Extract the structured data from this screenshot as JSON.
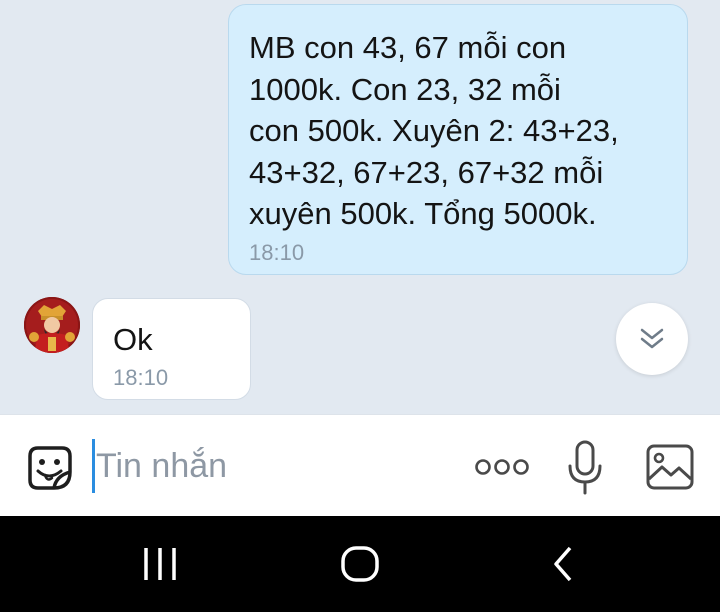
{
  "messages": {
    "outgoing": {
      "text": "MB con 43, 67 mỗi con\n1000k. Con 23, 32 mỗi\ncon 500k. Xuyên 2: 43+23,\n43+32, 67+23, 67+32 mỗi\nxuyên 500k. Tổng 5000k.",
      "time": "18:10"
    },
    "incoming": {
      "text": "Ok",
      "time": "18:10"
    }
  },
  "composer": {
    "placeholder": "Tin nhắn",
    "value": ""
  },
  "icons": {
    "emoji": "smiley-sticker-icon",
    "more": "more-dots-icon",
    "mic": "microphone-icon",
    "image": "image-gallery-icon",
    "scroll": "chevron-double-down-icon",
    "nav_recents": "recents-icon",
    "nav_home": "home-icon",
    "nav_back": "back-icon"
  },
  "colors": {
    "chat_background": "#e2e9f1",
    "outgoing_bubble": "#d5eefd",
    "incoming_bubble": "#ffffff",
    "cursor": "#2a8de0",
    "timestamp": "#8a99a8"
  }
}
